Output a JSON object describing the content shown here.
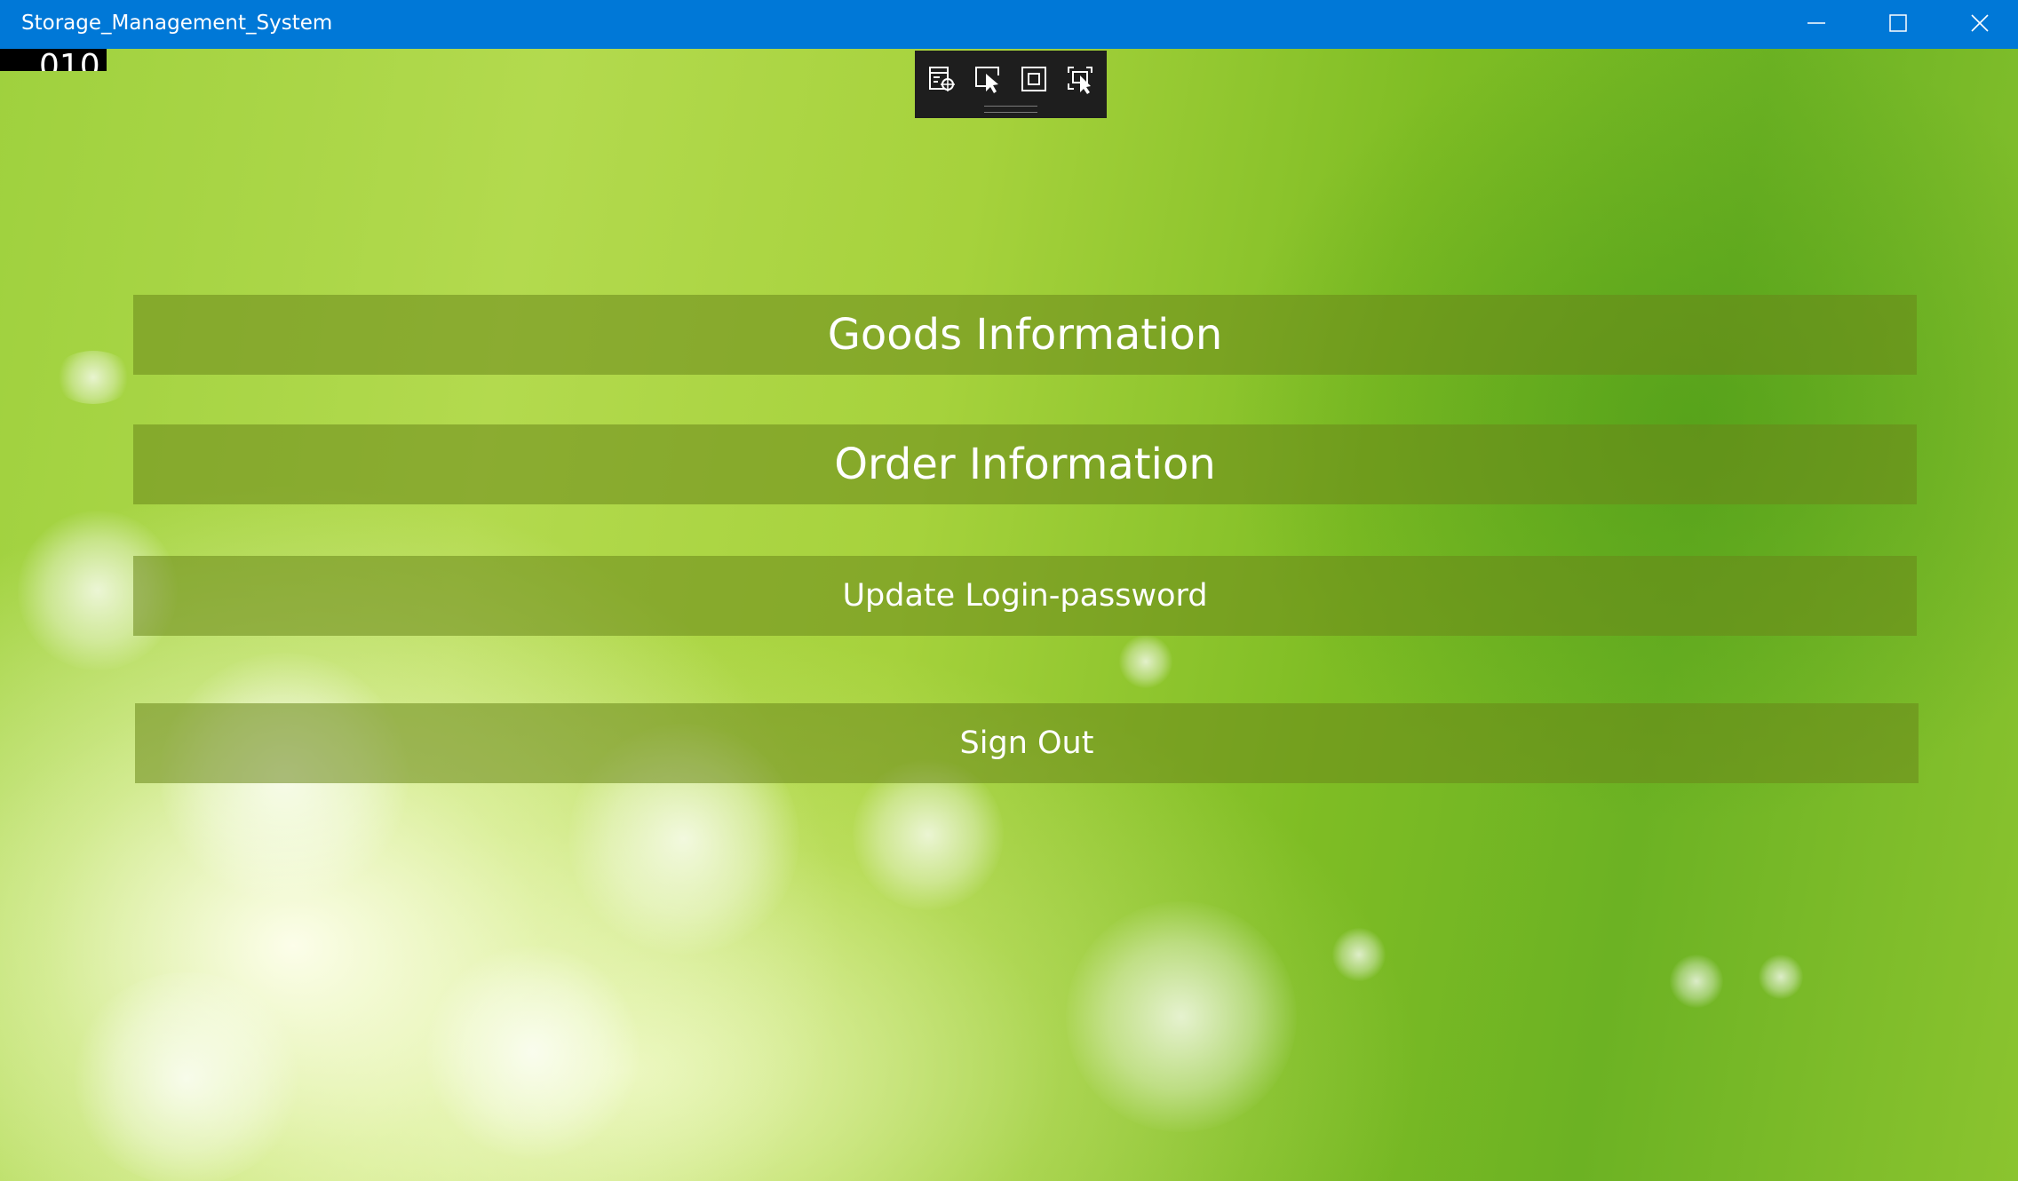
{
  "window": {
    "title": "Storage_Management_System"
  },
  "overlay": {
    "counter_text": "010"
  },
  "debug_toolbar": {
    "tools": [
      "live-visual-tree-icon",
      "select-element-icon",
      "display-layout-adorners-icon",
      "track-focused-element-icon"
    ]
  },
  "menu": {
    "goods_label": "Goods Information",
    "order_label": "Order Information",
    "update_password_label": "Update Login-password",
    "sign_out_label": "Sign Out"
  },
  "colors": {
    "titlebar": "#0078d7",
    "button_overlay": "#698719"
  }
}
